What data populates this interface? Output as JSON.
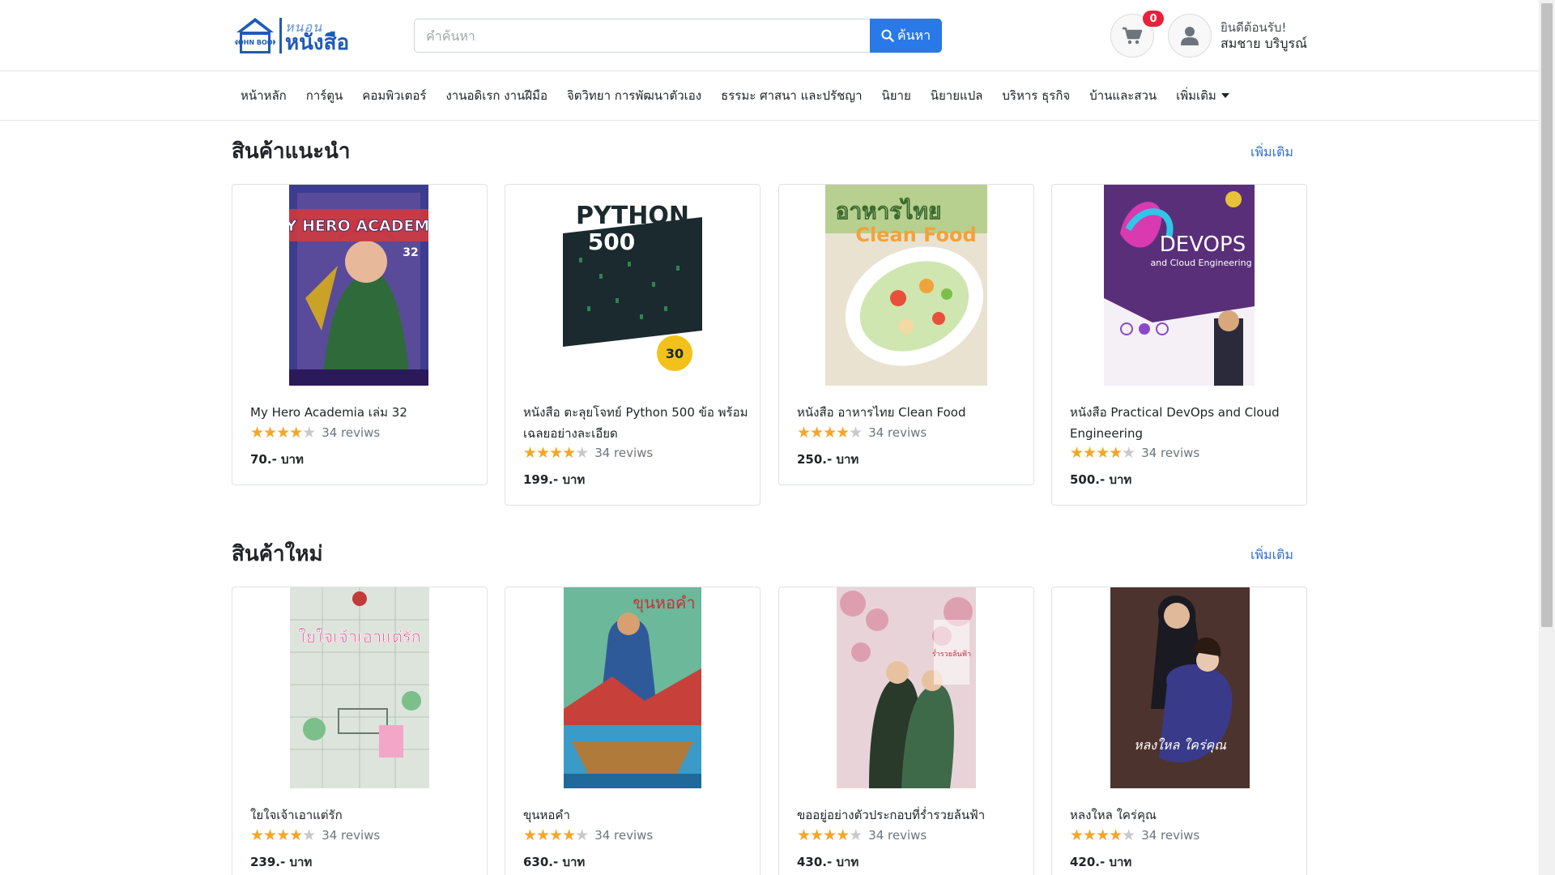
{
  "header": {
    "logo_top": "หนอน",
    "logo_main": "หนังสือ",
    "logo_badge": "NOHN BOOK",
    "search_placeholder": "คำค้นหา",
    "search_button": "ค้นหา",
    "cart_count": "0",
    "greeting": "ยินดีต้อนรับ!",
    "username": "สมชาย บริบูรณ์"
  },
  "nav": {
    "items": [
      "หน้าหลัก",
      "การ์ตูน",
      "คอมพิวเตอร์",
      "งานอดิเรก งานฝีมือ",
      "จิตวิทยา การพัฒนาตัวเอง",
      "ธรรมะ ศาสนา และปรัชญา",
      "นิยาย",
      "นิยายแปล",
      "บริหาร ธุรกิจ",
      "บ้านและสวน"
    ],
    "more": "เพิ่มเติม"
  },
  "sections": [
    {
      "title": "สินค้าแนะนำ",
      "more": "เพิ่มเติม",
      "products": [
        {
          "title": "My Hero Academia เล่ม 32",
          "stars": 4,
          "reviews": "34 reviws",
          "price": "70.- บาท",
          "cover_text": "MY HERO ACADEMIA",
          "cover_sub": "32"
        },
        {
          "title": "หนังสือ ตะลุยโจทย์ Python 500 ข้อ พร้อมเฉลยอย่างละเอียด",
          "stars": 4,
          "reviews": "34 reviws",
          "price": "199.- บาท",
          "cover_text": "PYTHON",
          "cover_sub": "500"
        },
        {
          "title": "หนังสือ อาหารไทย Clean Food",
          "stars": 4,
          "reviews": "34 reviws",
          "price": "250.- บาท",
          "cover_text": "อาหารไทย",
          "cover_sub": "Clean Food"
        },
        {
          "title": "หนังสือ Practical DevOps and Cloud Engineering",
          "stars": 4,
          "reviews": "34 reviws",
          "price": "500.- บาท",
          "cover_text": "DEVOPS",
          "cover_sub": "and Cloud Engineering"
        }
      ]
    },
    {
      "title": "สินค้าใหม่",
      "more": "เพิ่มเติม",
      "products": [
        {
          "title": "ใยใจเจ้าเอาแต่รัก",
          "stars": 4,
          "reviews": "34 reviws",
          "price": "239.- บาท",
          "cover_text": "ใยใจเจ้าเอาแต่รัก",
          "cover_sub": ""
        },
        {
          "title": "ขุนหอคำ",
          "stars": 4,
          "reviews": "34 reviws",
          "price": "630.- บาท",
          "cover_text": "ขุนหอคำ",
          "cover_sub": ""
        },
        {
          "title": "ขออยู่อย่างตัวประกอบที่ร่ำรวยล้นฟ้า",
          "stars": 4,
          "reviews": "34 reviws",
          "price": "430.- บาท",
          "cover_text": "ร่ำรวยล้นฟ้า",
          "cover_sub": ""
        },
        {
          "title": "หลงใหล ใคร่คุณ",
          "stars": 4,
          "reviews": "34 reviws",
          "price": "420.- บาท",
          "cover_text": "หลงใหล ใคร่คุณ",
          "cover_sub": ""
        }
      ]
    }
  ],
  "colors": {
    "brand": "#1e5bb8",
    "accent": "#2979e8",
    "link": "#2d6fd6",
    "star": "#f5a623",
    "badge": "#e8203a"
  }
}
